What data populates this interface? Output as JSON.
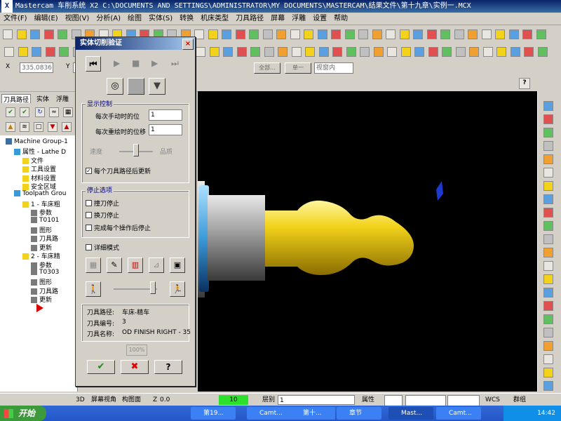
{
  "window": {
    "title": "Mastercam 车削系统  X2  C:\\DOCUMENTS AND SETTINGS\\ADMINISTRATOR\\MY DOCUMENTS\\MASTERCAM\\结果文件\\第十九章\\实例一.MCX"
  },
  "menu": [
    "文件(F)",
    "编辑(E)",
    "视图(V)",
    "分析(A)",
    "绘图",
    "实体(S)",
    "转换",
    "机床类型",
    "刀具路径",
    "屏幕",
    "浮雕",
    "设置",
    "帮助"
  ],
  "coordbar": {
    "x_label": "X",
    "x_value": "335.0836",
    "y_label": "Y",
    "mode1": "全部...",
    "mode2": "单一",
    "mode3": "视窗内"
  },
  "panel": {
    "tabs": [
      "刀具路径",
      "实体",
      "浮雕"
    ],
    "tree": [
      {
        "label": "Machine Group-1",
        "level": 0
      },
      {
        "label": "属性 - Lathe D",
        "level": 1
      },
      {
        "label": "文件",
        "level": 2
      },
      {
        "label": "工具设置",
        "level": 2
      },
      {
        "label": "材料设置",
        "level": 2
      },
      {
        "label": "安全区域",
        "level": 2
      },
      {
        "label": "Toolpath Grou",
        "level": 1
      },
      {
        "label": "1 - 车床粗",
        "level": 2
      },
      {
        "label": "参数",
        "level": 3
      },
      {
        "label": "T0101",
        "level": 3
      },
      {
        "label": "图形",
        "level": 3
      },
      {
        "label": "刀具路",
        "level": 3
      },
      {
        "label": "更新",
        "level": 3
      },
      {
        "label": "2 - 车床精",
        "level": 2
      },
      {
        "label": "参数",
        "level": 3
      },
      {
        "label": "T0303",
        "level": 3
      },
      {
        "label": "图形",
        "level": 3
      },
      {
        "label": "刀具路",
        "level": 3
      },
      {
        "label": "更新",
        "level": 3
      }
    ]
  },
  "dialog": {
    "title": "实体切削验证",
    "close": "×",
    "display_group": "显示控制",
    "step_move_label": "每次手动时的位",
    "step_move_value": "1",
    "step_redraw_label": "每次重绘时的位移",
    "step_redraw_value": "1",
    "speed_label": "速度",
    "quality_label": "品质",
    "update_each_label": "每个刀具路径后更新",
    "stop_group": "停止选项",
    "stop_collision": "撞刀停止",
    "stop_toolchange": "换刀停止",
    "stop_after_op": "完成每个操作后停止",
    "detail_mode": "详细模式",
    "info_path_label": "刀具路径:",
    "info_path_value": "车床-精车",
    "info_num_label": "刀具编号:",
    "info_num_value": "3",
    "info_name_label": "刀具名称:",
    "info_name_value": "OD FINISH RIGHT - 35",
    "percent": "100%",
    "ok": "✔",
    "cancel": "✖",
    "help": "?"
  },
  "statusbar": {
    "d3": "3D",
    "screen_view": "屏幕视角",
    "construct_plane": "构图面",
    "z_label": "Z",
    "z_value": "0.0",
    "color_value": "10",
    "layer_label": "层别",
    "layer_value": "1",
    "attr": "属性",
    "wcs": "WCS",
    "group": "群组"
  },
  "taskbar": {
    "start": "开始",
    "tasks": [
      "第19...",
      "Camt...",
      "第十...",
      "章节",
      "Mast...",
      "Camt..."
    ],
    "clock": "14:42"
  },
  "colors": {
    "title_bg": "#0a246a",
    "viewport_bg": "#000000",
    "part_yellow": "#f2d21a",
    "taskbar": "#2456c8",
    "start_green": "#3c9a3a"
  }
}
